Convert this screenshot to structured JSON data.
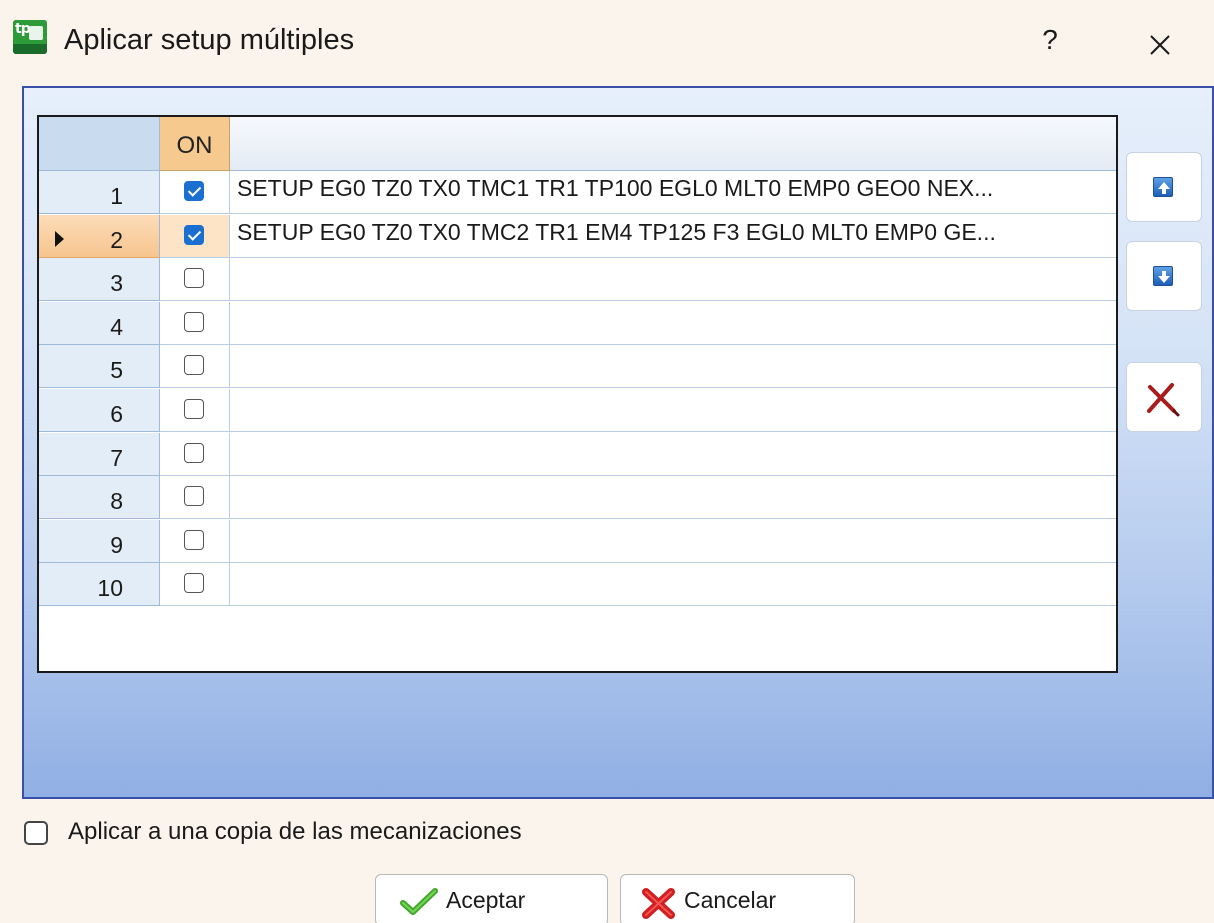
{
  "window": {
    "title": "Aplicar setup múltiples",
    "help_label": "?"
  },
  "grid": {
    "column_on_label": "ON",
    "rows": [
      {
        "number": "1",
        "on": true,
        "text": "SETUP EG0 TZ0 TX0 TMC1 TR1 TP100 EGL0 MLT0 EMP0 GEO0 NEX...",
        "selected": false
      },
      {
        "number": "2",
        "on": true,
        "text": "SETUP EG0 TZ0 TX0 TMC2 TR1 EM4 TP125 F3 EGL0 MLT0 EMP0 GE...",
        "selected": true
      },
      {
        "number": "3",
        "on": false,
        "text": "",
        "selected": false
      },
      {
        "number": "4",
        "on": false,
        "text": "",
        "selected": false
      },
      {
        "number": "5",
        "on": false,
        "text": "",
        "selected": false
      },
      {
        "number": "6",
        "on": false,
        "text": "",
        "selected": false
      },
      {
        "number": "7",
        "on": false,
        "text": "",
        "selected": false
      },
      {
        "number": "8",
        "on": false,
        "text": "",
        "selected": false
      },
      {
        "number": "9",
        "on": false,
        "text": "",
        "selected": false
      },
      {
        "number": "10",
        "on": false,
        "text": "",
        "selected": false
      }
    ]
  },
  "side_buttons": {
    "move_up_icon": "arrow-up-icon",
    "move_down_icon": "arrow-down-icon",
    "delete_icon": "delete-x-icon"
  },
  "options": {
    "apply_copy_label": "Aplicar a una copia de las mecanizaciones",
    "apply_copy_checked": false
  },
  "footer": {
    "accept_label": "Aceptar",
    "cancel_label": "Cancelar"
  },
  "colors": {
    "accent_checkbox": "#1a6fd0",
    "selected_row": "#f7c58f",
    "panel_border": "#3850a8",
    "delete_red": "#a81c1c"
  }
}
